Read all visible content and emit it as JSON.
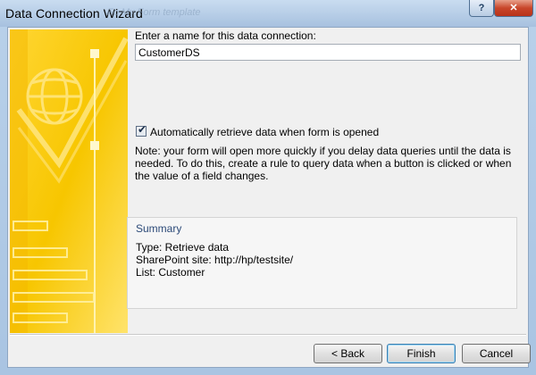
{
  "window": {
    "title": "Data Connection Wizard",
    "ghost_text": "Fo My Form template"
  },
  "title_buttons": {
    "help": "?",
    "close": "✕"
  },
  "name_field": {
    "label": "Enter a name for this data connection:",
    "value": "CustomerDS"
  },
  "auto_retrieve": {
    "checked": true,
    "label": "Automatically retrieve data when form is opened"
  },
  "note": "Note: your form will open more quickly if you delay data queries until the data is needed. To do this, create a rule to query data when a button is clicked or when the value of a field changes.",
  "summary": {
    "title": "Summary",
    "lines": [
      "Type: Retrieve data",
      "SharePoint site: http://hp/testsite/",
      "List: Customer"
    ]
  },
  "buttons": {
    "back": "< Back",
    "finish": "Finish",
    "cancel": "Cancel"
  },
  "colors": {
    "art_yellow": "#f7c600",
    "title_bar": "#a7c1df",
    "dialog_bg": "#f0f0f0"
  }
}
